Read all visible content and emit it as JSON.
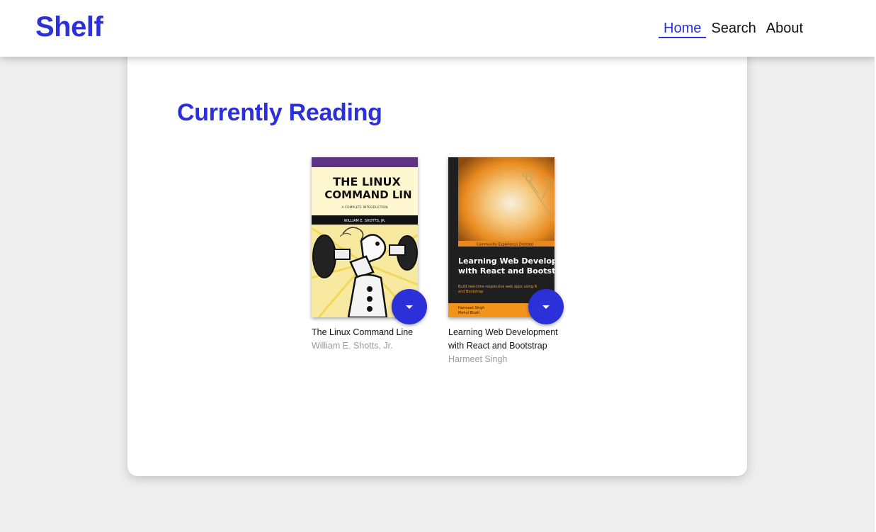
{
  "app": {
    "logo": "Shelf"
  },
  "nav": {
    "items": [
      {
        "label": "Home",
        "active": true
      },
      {
        "label": "Search",
        "active": false
      },
      {
        "label": "About",
        "active": false
      }
    ]
  },
  "main": {
    "section_title": "Currently Reading",
    "books": [
      {
        "title": "The Linux Command Line",
        "author": "William E. Shotts, Jr.",
        "cover": {
          "line1": "THE LINUX",
          "line2": "COMMAND LIN",
          "subtitle": "A COMPLETE INTRODUCTION",
          "byline": "WILLIAM E. SHOTTS, JR."
        },
        "shelf_menu_icon": "caret-down-icon"
      },
      {
        "title": "Learning Web Development with React and Bootstrap",
        "author": "Harmeet Singh",
        "cover": {
          "series": "Community Experience Distilled",
          "line1": "Learning Web Developm",
          "line2": "with React and Bootstrap",
          "tagline1": "Build real-time responsive web apps using R",
          "tagline2": "and Bootstrap",
          "author1": "Harmeet Singh",
          "author2": "Mehul Bhatt"
        },
        "shelf_menu_icon": "caret-down-icon"
      }
    ]
  },
  "colors": {
    "accent": "#2b30d9",
    "background": "#eeeeee",
    "author_text": "#9a9a9a"
  }
}
